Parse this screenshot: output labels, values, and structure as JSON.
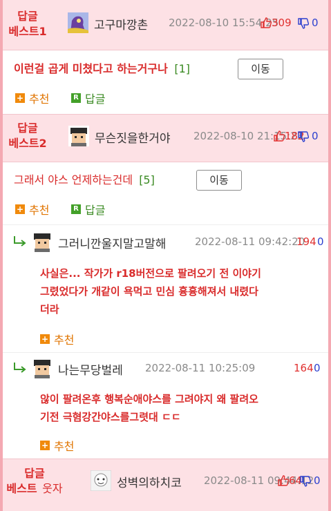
{
  "best1": {
    "label_line1": "답글",
    "label_line2": "베스트1",
    "nick": "고구마깡촌",
    "date": "2022-08-10 15:54:25",
    "up": "309",
    "down": "0",
    "body": "이런걸 곱게 미쳤다고 하는거구나",
    "reply_count": "[1]",
    "move_label": "이동",
    "recommend_label": "추천",
    "reply_label": "답글"
  },
  "best2": {
    "label_line1": "답글",
    "label_line2": "베스트2",
    "nick": "무슨짓을한거야",
    "date": "2022-08-10 21:15:23",
    "up": "182",
    "down": "0",
    "body": "그래서 야스 언제하는건데",
    "reply_count": "[5]",
    "move_label": "이동",
    "recommend_label": "추천",
    "reply_label": "답글"
  },
  "replies": [
    {
      "nick": "그러니깐울지말고말해",
      "date": "2022-08-11 09:42:20",
      "up": "194",
      "down": "0",
      "body_line1": "사실은... 작가가 r18버전으로 팔려오기 전 이야기",
      "body_line2": "그렸었다가 개같이 욕먹고 민심 흉흉해져서 내렸다",
      "body_line3": "더라",
      "recommend_label": "추천"
    },
    {
      "nick": "나는무당벌레",
      "date": "2022-08-11 10:25:09",
      "up": "164",
      "down": "0",
      "body_line1": "않이 팔려온후 행복순애야스를 그려야지 왜 팔려오",
      "body_line2": "기전 극혐강간야스를그렷대 ㄷㄷ",
      "recommend_label": "추천"
    }
  ],
  "best_laugh": {
    "label_line1": "답글",
    "label_best": "베스트",
    "label_laugh": "웃자",
    "nick": "성벽의하치코",
    "date": "2022-08-11 09:44:12",
    "up": "64",
    "down": "0"
  },
  "colors": {
    "accent_red": "#d92b2b",
    "best_bg": "#fde1e5",
    "frame_pink": "#f4a9b2",
    "recommend_orange": "#e07400",
    "reply_green": "#3a8a22",
    "down_blue": "#2b3fcf"
  }
}
